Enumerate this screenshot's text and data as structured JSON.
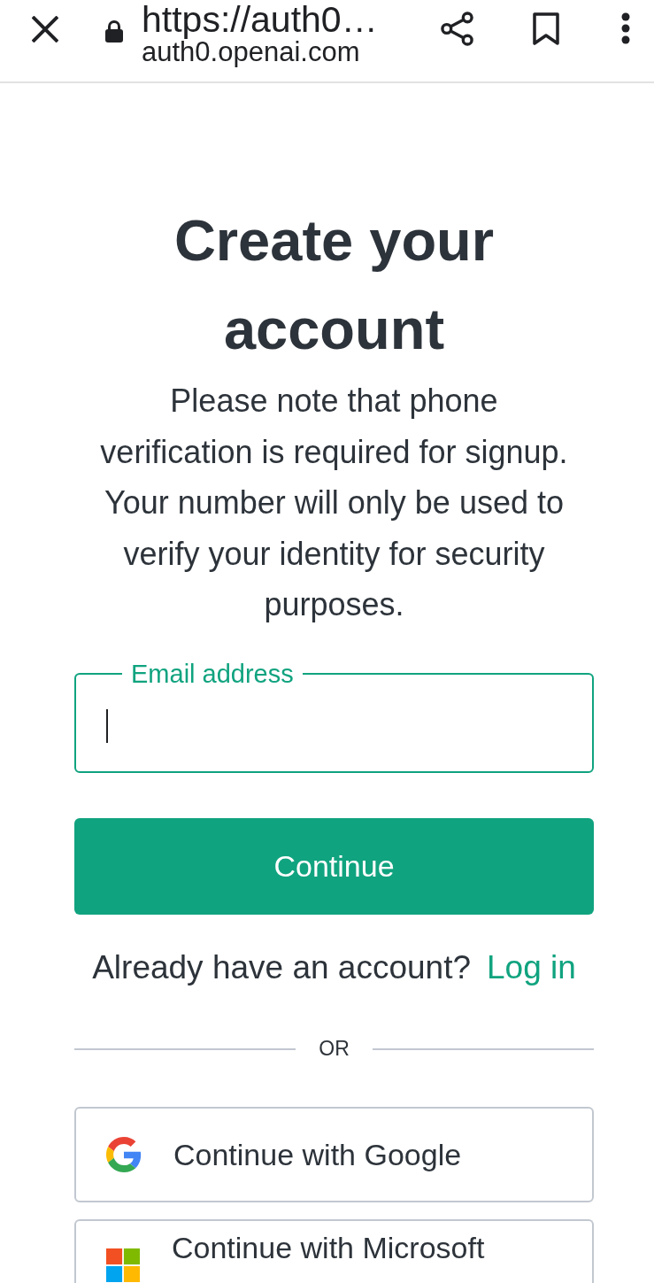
{
  "browser_bar": {
    "title": "https://auth0…",
    "url": "auth0.openai.com"
  },
  "heading": "Create your account",
  "notice": "Please note that phone verification is required for signup. Your number will only be used to verify your identity for security purposes.",
  "email_field": {
    "label": "Email address",
    "focused": true
  },
  "continue_button": "Continue",
  "login_prompt": {
    "text": "Already have an account?",
    "link": "Log in"
  },
  "divider": "OR",
  "social_buttons": [
    {
      "kind": "google",
      "label": "Continue with Google"
    },
    {
      "kind": "microsoft",
      "label": "Continue with Microsoft"
    }
  ]
}
